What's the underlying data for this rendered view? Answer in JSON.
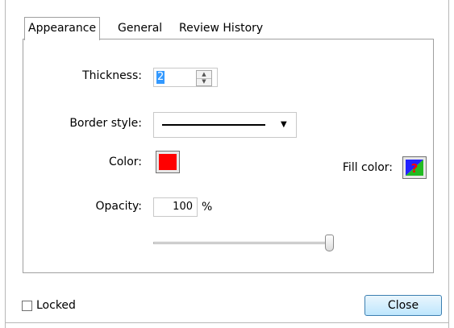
{
  "tabs": [
    {
      "label": "Appearance",
      "active": true
    },
    {
      "label": "General",
      "active": false
    },
    {
      "label": "Review History",
      "active": false
    }
  ],
  "appearance": {
    "thickness_label": "Thickness:",
    "thickness_value": "2",
    "border_style_label": "Border style:",
    "border_style_value": "solid",
    "color_label": "Color:",
    "color_value": "#ff0000",
    "fill_color_label": "Fill color:",
    "opacity_label": "Opacity:",
    "opacity_value": "100",
    "opacity_unit": "%",
    "opacity_slider_fraction": 1.0
  },
  "footer": {
    "locked_label": "Locked",
    "locked_checked": false,
    "close_label": "Close"
  }
}
